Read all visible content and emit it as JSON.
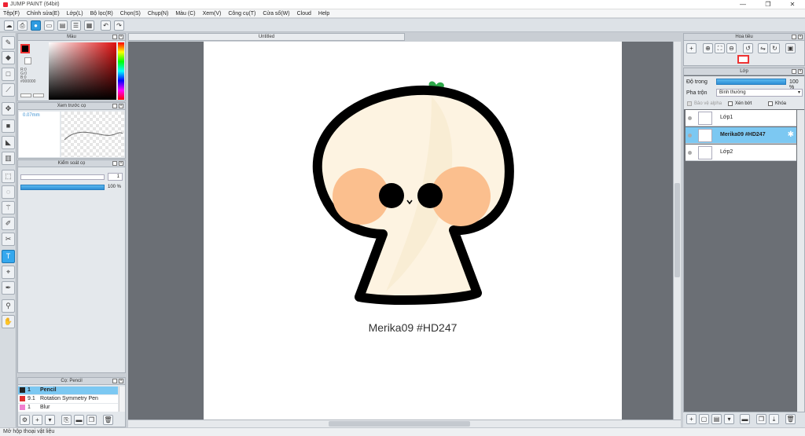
{
  "window": {
    "title": "JUMP PAINT (64bit)",
    "min": "—",
    "max": "❐",
    "close": "✕"
  },
  "menu": [
    "Tệp(F)",
    "Chỉnh sửa(E)",
    "Lớp(L)",
    "Bộ lọc(R)",
    "Chọn(S)",
    "Chụp(N)",
    "Màu (C)",
    "Xem(V)",
    "Công cụ(T)",
    "Cửa sổ(W)",
    "Cloud",
    "Help"
  ],
  "color_panel": {
    "title": "Màu",
    "r": "R:0",
    "g": "G:0",
    "b": "B:0",
    "hex": "#000000"
  },
  "brush_preview": {
    "title": "Xem trước cọ",
    "size": "0.07mm"
  },
  "brush_control": {
    "title": "Kiểm soát cọ",
    "size_value": "1",
    "opacity_value": "100 %"
  },
  "brush_list": {
    "title": "Cọ: Pencil",
    "items": [
      {
        "size": "1",
        "name": "Pencil",
        "color": "#222222"
      },
      {
        "size": "9.1",
        "name": "Rotation Symmetry Pen",
        "color": "#e03030"
      },
      {
        "size": "1",
        "name": "Blur",
        "color": "#f080d0"
      }
    ]
  },
  "document": {
    "tab": "Untitled",
    "caption": "Merika09 #HD247"
  },
  "navigator": {
    "title": "Hoa tiêu"
  },
  "layers": {
    "title": "Lớp",
    "opacity_label": "Độ trong",
    "opacity_value": "100 %",
    "blend_label": "Pha trộn",
    "blend_value": "Bình thường",
    "protect_alpha": "Bảo vệ alpha",
    "clipping": "Xén bớt",
    "lock": "Khóa",
    "items": [
      {
        "name": "Lớp1"
      },
      {
        "name": "Merika09 #HD247"
      },
      {
        "name": "Lớp2"
      }
    ]
  },
  "status": "Mở hộp thoại vật liệu",
  "colors": {
    "accent": "#35a8ee",
    "skin": "#fdf3e1",
    "cheek": "#fbbf8e",
    "outline": "#000000",
    "leaf": "#2ea84a"
  }
}
